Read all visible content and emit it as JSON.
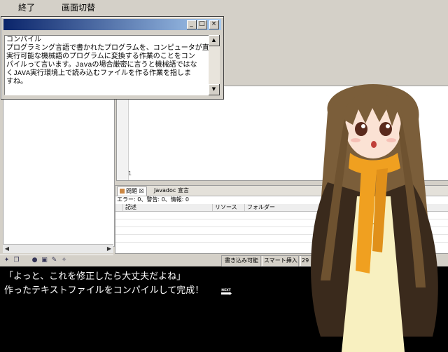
{
  "menu": {
    "end_label": "終了",
    "switch_label": "画面切替"
  },
  "popup": {
    "minimize": "_",
    "maximize": "□",
    "close": "×",
    "text": "コンパイル\nプログラミング言語で書かれたプログラムを、コンピュータが直接\n実行可能な機械語のプログラムに変換する作業のことをコン\nパイルって言います。Javaの場合厳密に言うと機械語ではな\nくJAVA実行環境上で読み込むファイルを作る作業を指しま\nすね。"
  },
  "ide": {
    "line_number": "1",
    "tabs": {
      "problems": "問題",
      "problems_close": "☒",
      "javadoc": "Javadoc",
      "declaration": "宣言"
    },
    "summary": "エラー: 0、警告: 0、情報: 0",
    "columns": {
      "description": "記述",
      "resource": "リソース",
      "folder": "フォルダー"
    },
    "status": {
      "writable": "書き込み可能",
      "insert": "スマート挿入",
      "position": "29 : 5"
    }
  },
  "dialogue": {
    "line1": "「よっと、これを修正したら大丈夫だよね」",
    "line2": "作ったテキストファイルをコンパイルして完成！",
    "next_label": "NEXT"
  },
  "colors": {
    "hair": "#7b5e3a",
    "scarf": "#f0a020",
    "coat": "#3a2a1c",
    "dress": "#f8f0c0",
    "titlebar": "#0a246a"
  }
}
